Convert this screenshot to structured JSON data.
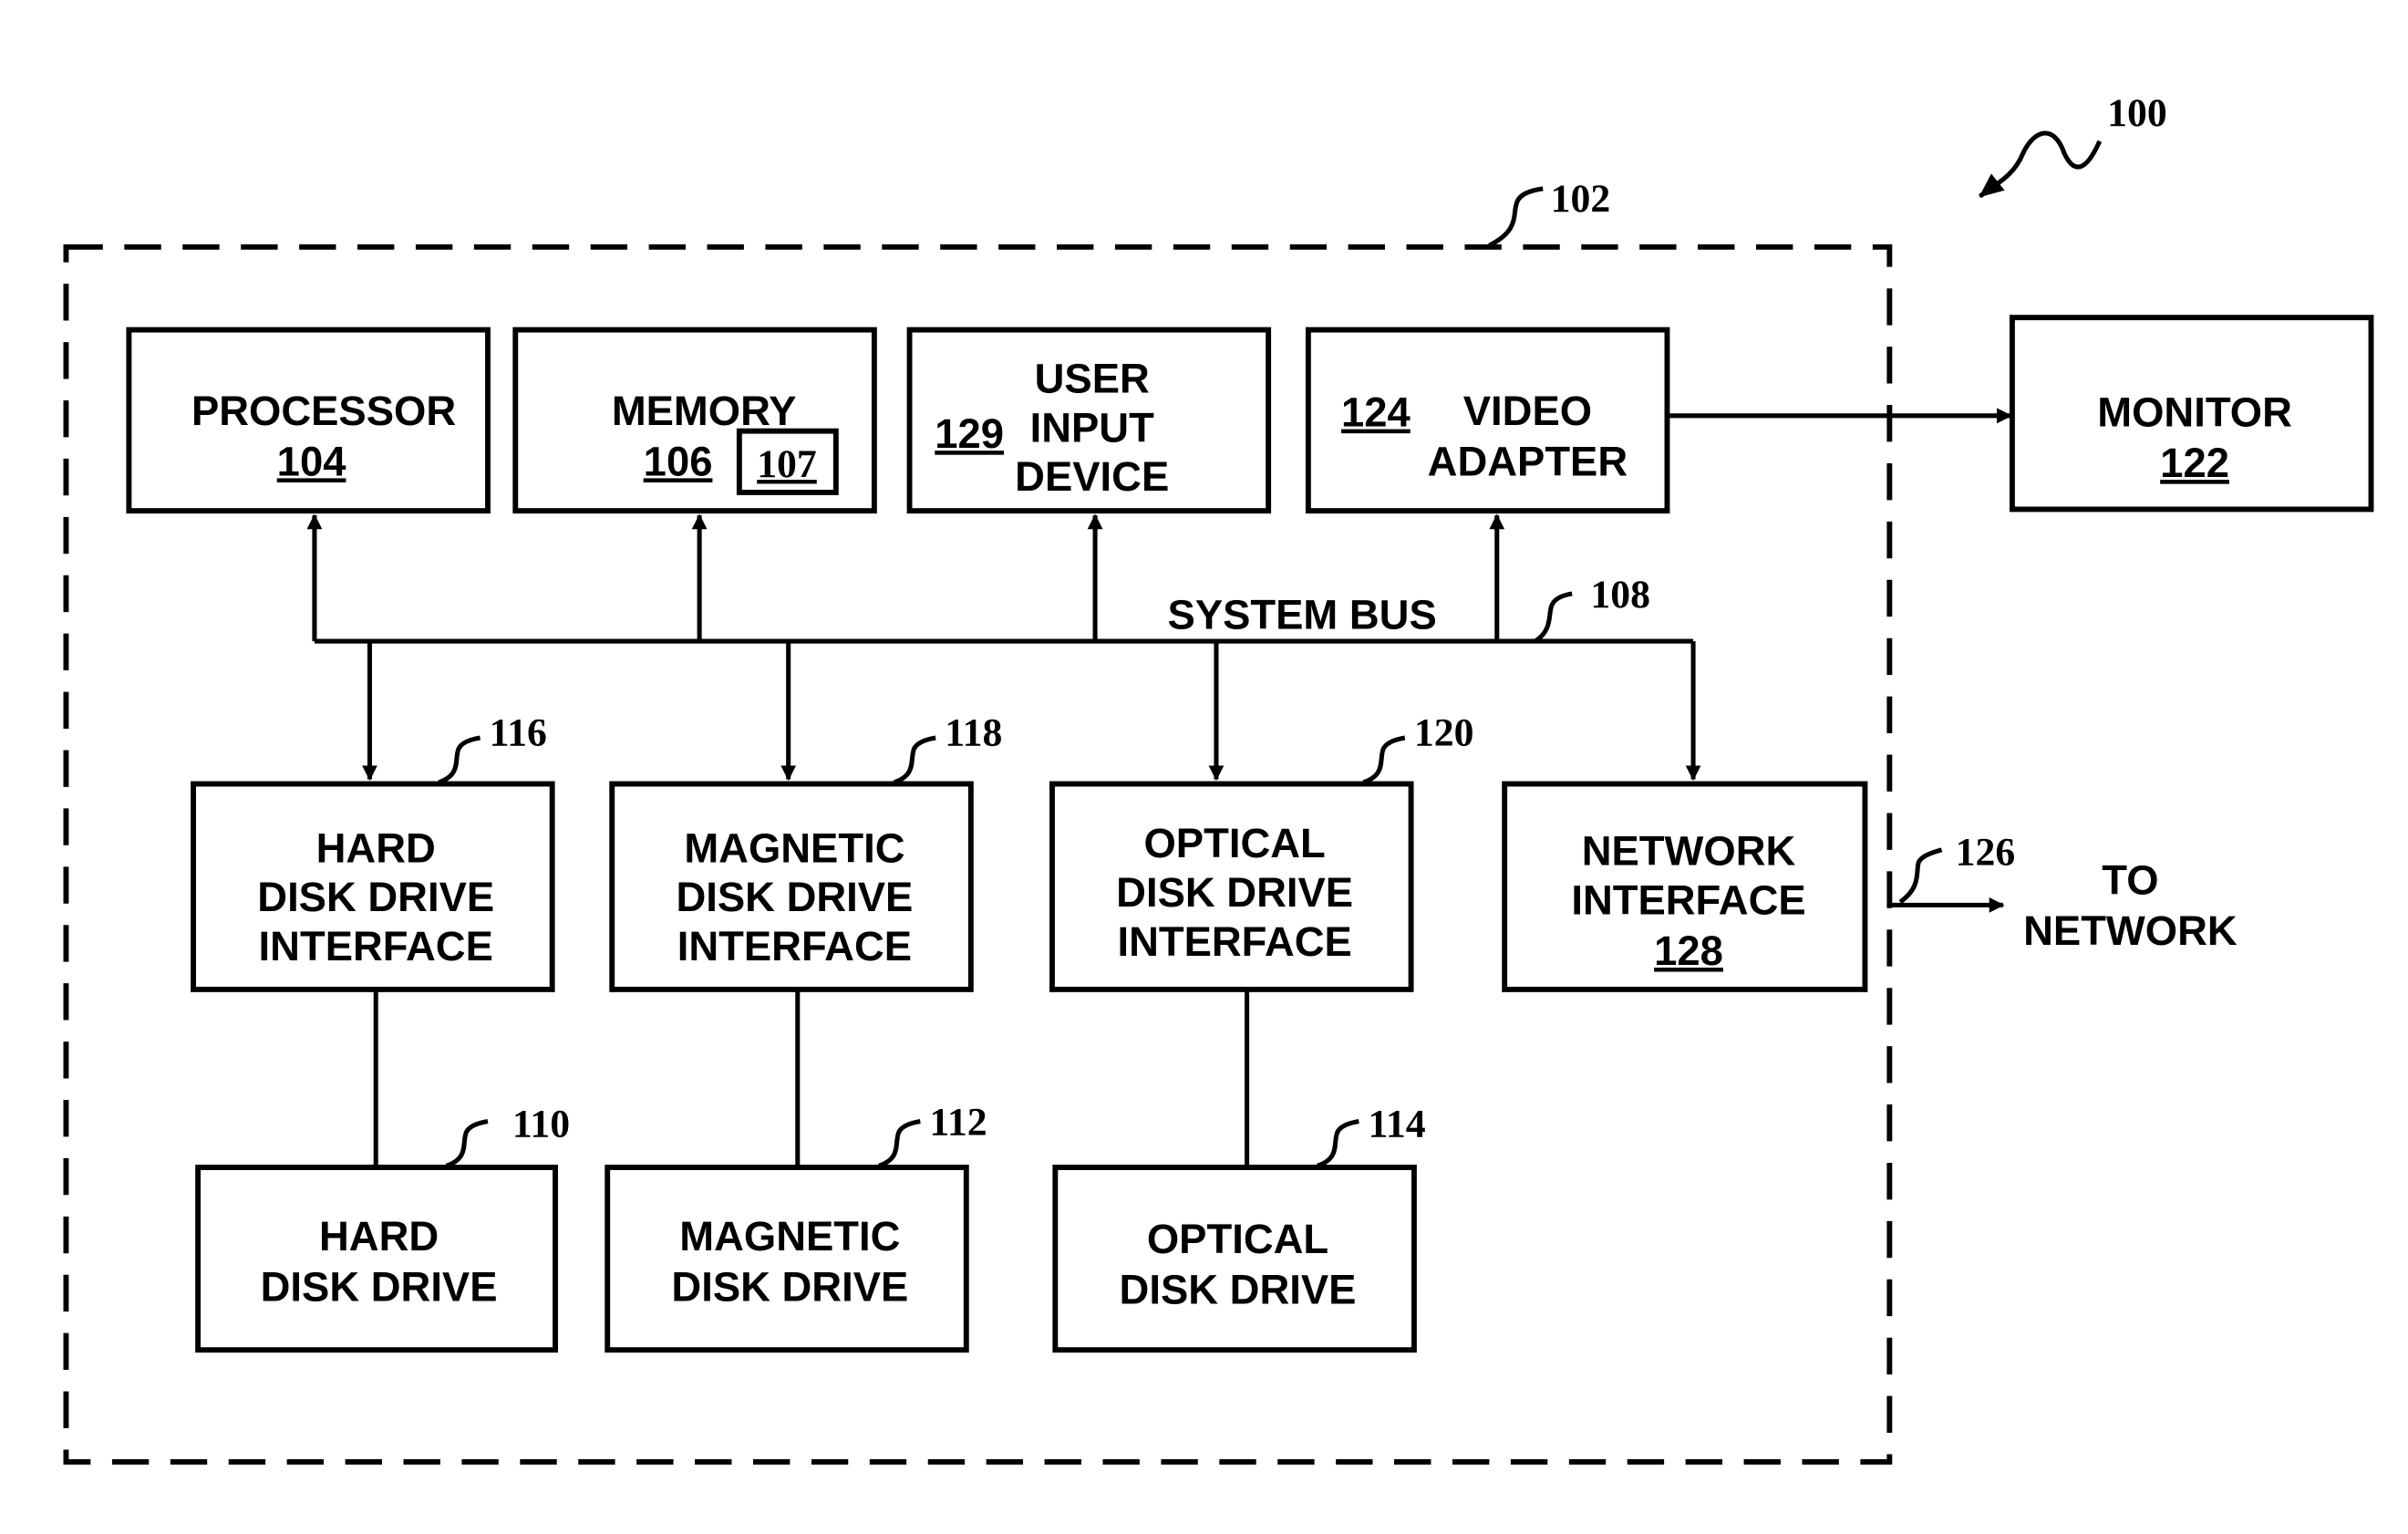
{
  "figure": {
    "ref": "100",
    "system": {
      "ref": "102"
    },
    "bus": {
      "label": "SYSTEM BUS",
      "ref": "108"
    },
    "components": {
      "processor": {
        "lines": [
          "PROCESSOR"
        ],
        "num": "104"
      },
      "memory": {
        "lines": [
          "MEMORY"
        ],
        "num": "106",
        "sub_num": "107"
      },
      "user_input": {
        "lines": [
          "USER",
          "INPUT",
          "DEVICE"
        ],
        "num": "129"
      },
      "video_adapter": {
        "lines": [
          "VIDEO",
          "ADAPTER"
        ],
        "num": "124"
      },
      "monitor": {
        "lines": [
          "MONITOR"
        ],
        "num": "122"
      },
      "hdd_interface": {
        "lines": [
          "HARD",
          "DISK DRIVE",
          "INTERFACE"
        ],
        "ref": "116"
      },
      "mdd_interface": {
        "lines": [
          "MAGNETIC",
          "DISK DRIVE",
          "INTERFACE"
        ],
        "ref": "118"
      },
      "odd_interface": {
        "lines": [
          "OPTICAL",
          "DISK DRIVE",
          "INTERFACE"
        ],
        "ref": "120"
      },
      "network_interface": {
        "lines": [
          "NETWORK",
          "INTERFACE"
        ],
        "num": "128"
      },
      "hdd": {
        "lines": [
          "HARD",
          "DISK DRIVE"
        ],
        "ref": "110"
      },
      "mdd": {
        "lines": [
          "MAGNETIC",
          "DISK DRIVE"
        ],
        "ref": "112"
      },
      "odd": {
        "lines": [
          "OPTICAL",
          "DISK DRIVE"
        ],
        "ref": "114"
      }
    },
    "network_link": {
      "ref": "126",
      "lines": [
        "TO",
        "NETWORK"
      ]
    }
  }
}
